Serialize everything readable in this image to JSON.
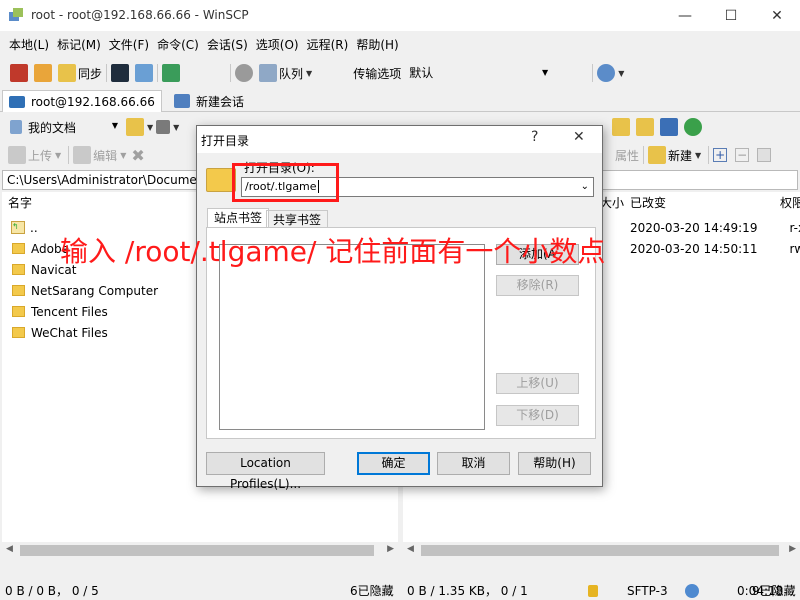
{
  "window": {
    "title": "root - root@192.168.66.66 - WinSCP",
    "minimize": "—",
    "maximize": "☐",
    "close": "✕"
  },
  "menu": [
    "本地(L)",
    "标记(M)",
    "文件(F)",
    "命令(C)",
    "会话(S)",
    "选项(O)",
    "远程(R)",
    "帮助(H)"
  ],
  "toolbar1": {
    "sync": "同步",
    "queue": "队列",
    "transfer_label": "传输选项",
    "transfer_value": "默认"
  },
  "session_tabs": {
    "active": "root@192.168.66.66",
    "new": "新建会话"
  },
  "local_toolbar": {
    "location": "我的文档"
  },
  "local_actions": {
    "upload": "上传",
    "edit": "编辑"
  },
  "remote_actions": {
    "properties": "属性",
    "new": "新建"
  },
  "local": {
    "path": "C:\\Users\\Administrator\\Documents",
    "column_name": "名字",
    "files": [
      "..",
      "Adobe",
      "Navicat",
      "NetSarang Computer",
      "Tencent Files",
      "WeChat Files"
    ]
  },
  "remote": {
    "columns": {
      "size": "大小",
      "changed": "已改变",
      "rights": "权限"
    },
    "rows": [
      {
        "changed": "2020-03-20 14:49:19",
        "rights": "r-x"
      },
      {
        "changed": "2020-03-20 14:50:11",
        "rights": "rw-"
      }
    ]
  },
  "status": {
    "left_sel": "0 B / 0 B，  0 / 5",
    "left_hidden": "6已隐藏",
    "right_sel": "0 B / 1.35 KB，  0 / 1",
    "right_hidden": "9已隐藏",
    "protocol": "SFTP-3",
    "time": "0:04:18"
  },
  "dialog": {
    "title": "打开目录",
    "help": "?",
    "close": "✕",
    "field_label": "打开目录(O):",
    "path_value": "/root/.tlgame",
    "tab_site": "站点书签",
    "tab_shared": "共享书签",
    "add": "添加(A",
    "remove": "移除(R)",
    "up": "上移(U)",
    "down": "下移(D)",
    "location_profiles": "Location Profiles(L)...",
    "ok": "确定",
    "cancel": "取消",
    "help_btn": "帮助(H)"
  },
  "annotation": "输入 /root/.tlgame/  记住前面有一个小数点",
  "colors": {
    "annotation": "#ff1a1a",
    "accent": "#0078d7"
  }
}
